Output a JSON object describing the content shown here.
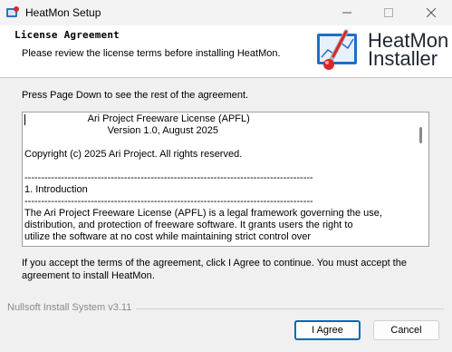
{
  "window": {
    "title": "HeatMon Setup",
    "minimize_icon": "minimize-icon",
    "maximize_icon": "maximize-icon",
    "close_icon": "close-icon"
  },
  "header": {
    "title": "License Agreement",
    "subtitle": "Please review the license terms before installing HeatMon.",
    "logo_line1": "HeatMon",
    "logo_line2": "Installer"
  },
  "instruction": "Press Page Down to see the rest of the agreement.",
  "license": {
    "text": "                       Ari Project Freeware License (APFL)\n                              Version 1.0, August 2025\n\nCopyright (c) 2025 Ari Project. All rights reserved.\n\n---------------------------------------------------------------------------------------\n1. Introduction\n---------------------------------------------------------------------------------------\nThe Ari Project Freeware License (APFL) is a legal framework governing the use,\ndistribution, and protection of freeware software. It grants users the right to\nutilize the software at no cost while maintaining strict control over"
  },
  "accept_text": "If you accept the terms of the agreement, click I Agree to continue. You must accept the agreement to install HeatMon.",
  "footer": {
    "brand": "Nullsoft Install System v3.11"
  },
  "buttons": {
    "agree": "I Agree",
    "cancel": "Cancel"
  },
  "colors": {
    "accent": "#0067c0",
    "logo_red": "#d9262b",
    "logo_blue": "#1f6fc7"
  }
}
